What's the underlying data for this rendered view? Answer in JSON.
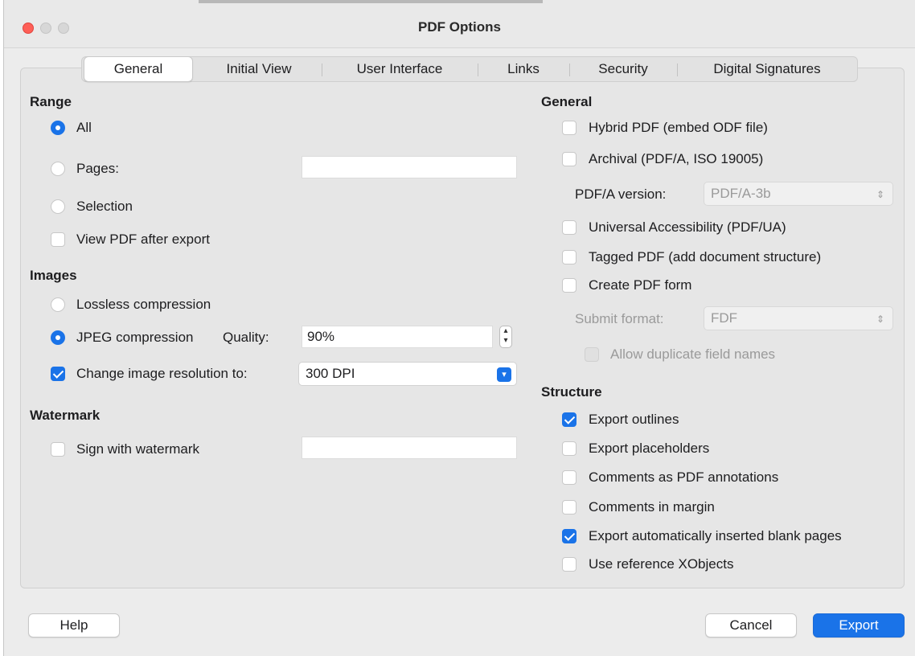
{
  "window": {
    "title": "PDF Options"
  },
  "tabs": [
    {
      "label": "General"
    },
    {
      "label": "Initial View"
    },
    {
      "label": "User Interface"
    },
    {
      "label": "Links"
    },
    {
      "label": "Security"
    },
    {
      "label": "Digital Signatures"
    }
  ],
  "range": {
    "heading": "Range",
    "all_label": "All",
    "pages_label": "Pages:",
    "pages_value": "",
    "selection_label": "Selection",
    "view_pdf_label": "View PDF after export"
  },
  "images": {
    "heading": "Images",
    "lossless_label": "Lossless compression",
    "jpeg_label": "JPEG compression",
    "quality_label": "Quality:",
    "quality_value": "90%",
    "resolution_label": "Change image resolution to:",
    "resolution_value": "300 DPI"
  },
  "watermark": {
    "heading": "Watermark",
    "sign_label": "Sign with watermark",
    "text_value": ""
  },
  "general": {
    "heading": "General",
    "hybrid_label": "Hybrid PDF (embed ODF file)",
    "archival_label": "Archival (PDF/A, ISO 19005)",
    "pdfa_version_label": "PDF/A version:",
    "pdfa_version_value": "PDF/A-3b",
    "ua_label": "Universal Accessibility (PDF/UA)",
    "tagged_label": "Tagged PDF (add document structure)",
    "form_label": "Create PDF form",
    "submit_format_label": "Submit format:",
    "submit_format_value": "FDF",
    "duplicate_label": "Allow duplicate field names"
  },
  "structure": {
    "heading": "Structure",
    "outlines_label": "Export outlines",
    "placeholders_label": "Export placeholders",
    "comments_pdf_label": "Comments as PDF annotations",
    "comments_margin_label": "Comments in margin",
    "blank_pages_label": "Export automatically inserted blank pages",
    "xobjects_label": "Use reference XObjects"
  },
  "buttons": {
    "help": "Help",
    "cancel": "Cancel",
    "export": "Export"
  },
  "colors": {
    "accent": "#1a73e8",
    "close_button": "#fe5f57"
  }
}
